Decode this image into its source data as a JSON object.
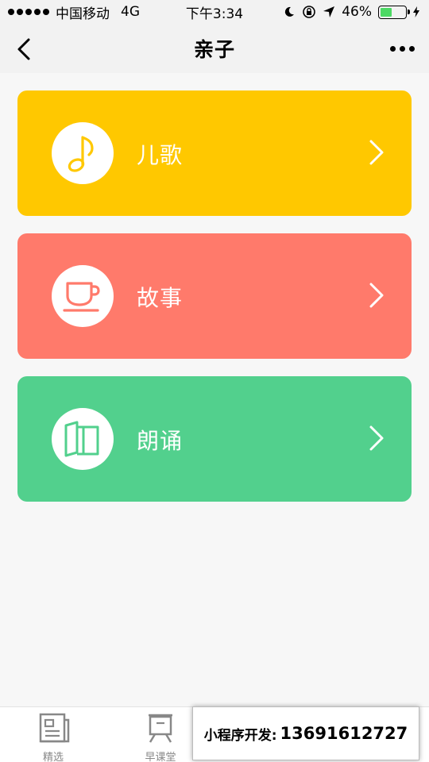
{
  "status_bar": {
    "carrier": "中国移动",
    "network": "4G",
    "time": "下午3:34",
    "battery_percent": "46%",
    "battery_level": 0.46
  },
  "nav": {
    "title": "亲子"
  },
  "cards": [
    {
      "label": "儿歌",
      "icon": "music-note-icon",
      "color": "#ffc800"
    },
    {
      "label": "故事",
      "icon": "cup-icon",
      "color": "#ff7a6b"
    },
    {
      "label": "朗诵",
      "icon": "book-icon",
      "color": "#52d08d"
    }
  ],
  "tabs": [
    {
      "label": "精选",
      "icon": "newspaper-icon"
    },
    {
      "label": "早课堂",
      "icon": "easel-icon"
    }
  ],
  "promo": {
    "label": "小程序开发:",
    "phone": "13691612727"
  }
}
